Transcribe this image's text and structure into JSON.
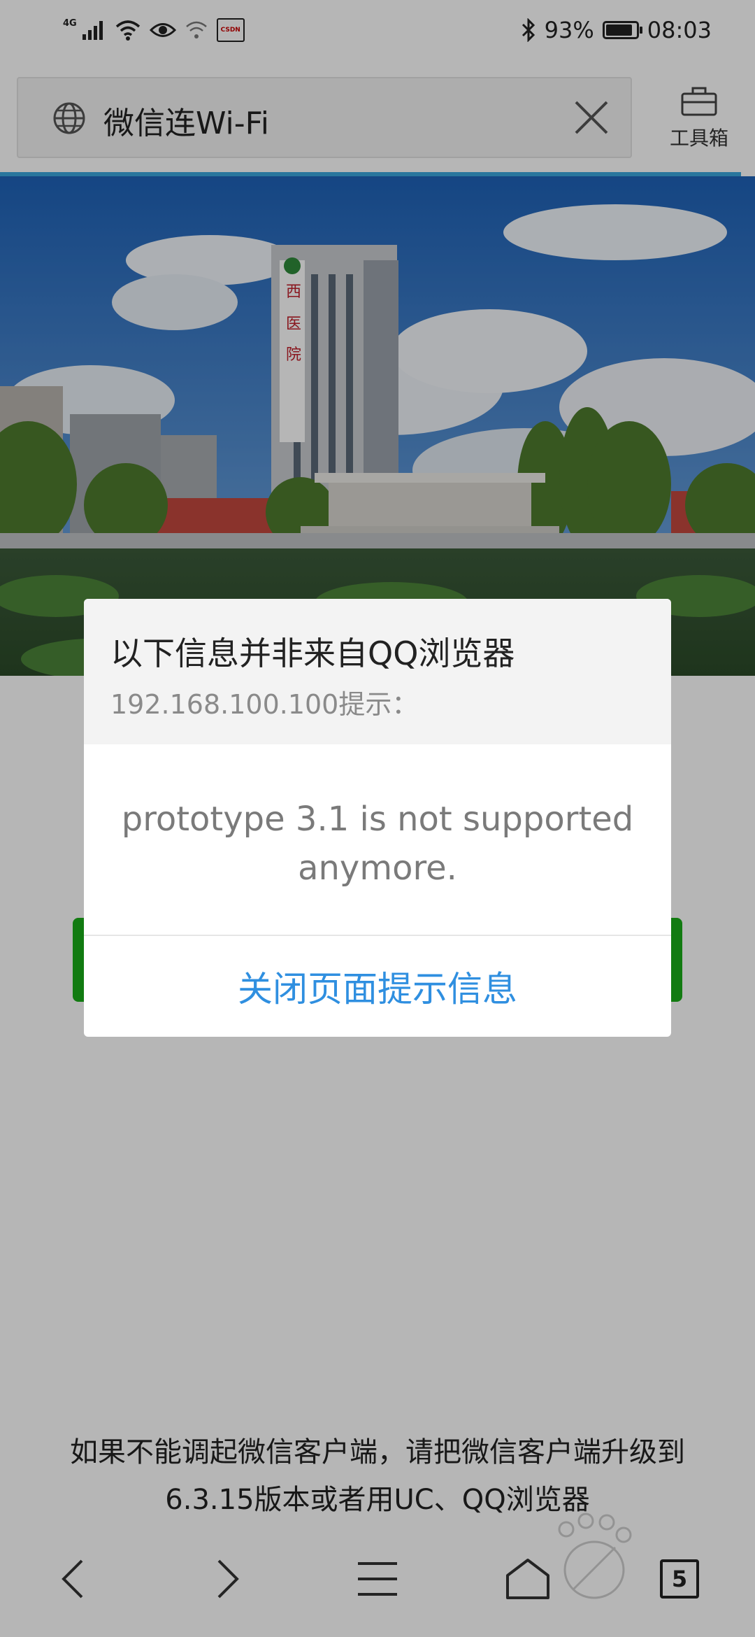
{
  "status_bar": {
    "network": "4G",
    "csdn_badge": "CSDN",
    "battery": "93%",
    "battery_level": 0.93,
    "time": "08:03"
  },
  "address_bar": {
    "url_text": "微信连Wi-Fi",
    "toolbox_label": "工具箱"
  },
  "page": {
    "hint": "如果不能调起微信客户端，请把微信客户端升级到6.3.15版本或者用UC、QQ浏览器"
  },
  "dialog": {
    "title": "以下信息并非来自QQ浏览器",
    "subtitle": "192.168.100.100提示：",
    "message": "prototype 3.1 is not supported anymore.",
    "action": "关闭页面提示信息"
  },
  "bottom_nav": {
    "tab_count": "5"
  },
  "colors": {
    "accent_blue": "#2f8fe0",
    "progress_blue": "#3aa6dd",
    "wechat_green": "#1aad19"
  }
}
